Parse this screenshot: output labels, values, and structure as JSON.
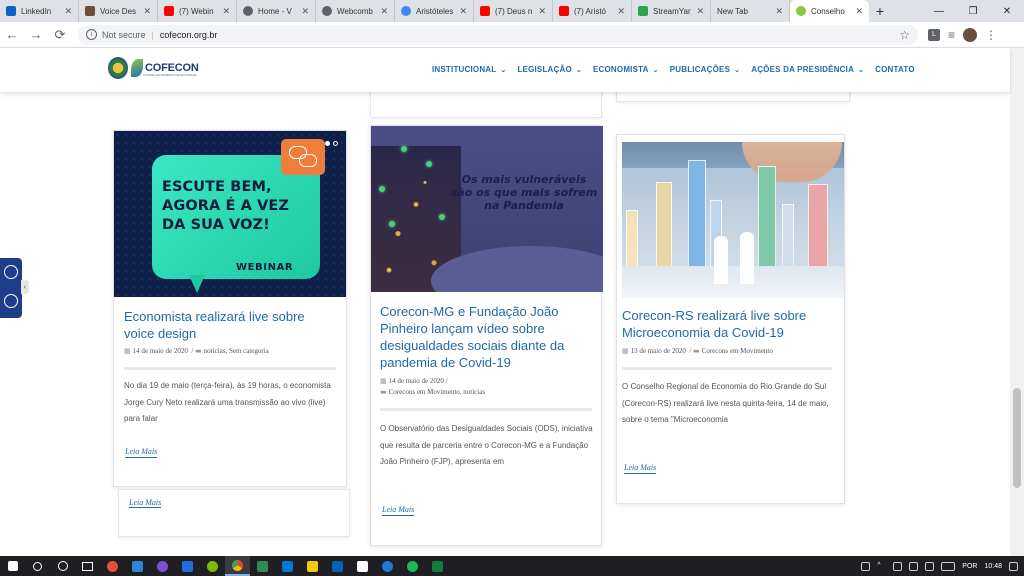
{
  "browser": {
    "tabs": [
      {
        "label": "LinkedIn",
        "color": "#0a66c2"
      },
      {
        "label": "Voice Des",
        "color": "#6b4e3d"
      },
      {
        "label": "(7) Webin",
        "color": "#ff0000"
      },
      {
        "label": "Home - V",
        "color": "#5f6368"
      },
      {
        "label": "Webcomb",
        "color": "#5f6368"
      },
      {
        "label": "Aristóteles",
        "color": "#4285f4"
      },
      {
        "label": "(7) Deus n",
        "color": "#ff0000"
      },
      {
        "label": "(7) Aristó",
        "color": "#ff0000"
      },
      {
        "label": "StreamYar",
        "color": "#2ea44f"
      },
      {
        "label": "New Tab",
        "color": "#dee1e6"
      },
      {
        "label": "Conselho",
        "color": "#8cc63f"
      }
    ],
    "close_glyph": "✕",
    "newtab_glyph": "+",
    "window_controls": [
      "—",
      "❐",
      "✕"
    ],
    "address": {
      "security": "Not secure",
      "separator": "|",
      "url": "cofecon.org.br"
    },
    "nav": {
      "back": "←",
      "forward": "→",
      "reload": "⟳"
    },
    "star": "☆",
    "extension_label": "L",
    "menu_glyph": "⋮",
    "media_glyph": "≡"
  },
  "site": {
    "logo_text": "COFECON",
    "logo_sub": "CONSELHO FEDERAL DE ECONOMIA",
    "nav": [
      {
        "label": "INSTITUCIONAL",
        "chev": "⌄"
      },
      {
        "label": "LEGISLAÇÃO",
        "chev": "⌄"
      },
      {
        "label": "ECONOMISTA",
        "chev": "⌄"
      },
      {
        "label": "PUBLICAÇÕES",
        "chev": "⌄"
      },
      {
        "label": "AÇÕES DA PRESIDÊNCIA",
        "chev": "⌄"
      },
      {
        "label": "CONTATO",
        "chev": ""
      }
    ],
    "accent": "#1f6aa8"
  },
  "posts": [
    {
      "title": "Economista realizará live sobre voice design",
      "date": "14 de maio de 2020",
      "categories": "notícias, Sem categoria",
      "excerpt": "No dia 19 de maio (terça-feira), às 19 horas, o economista Jorge Cury Neto realizará uma transmissão ao vivo (live) para falar",
      "more": "Leia Mais",
      "image_text": {
        "headline": "ESCUTE BEM, AGORA É A VEZ DA SUA VOZ!",
        "badge": "WEBINAR"
      }
    },
    {
      "title": "Corecon-MG e Fundação João Pinheiro lançam vídeo sobre desigualdades sociais diante da pandemia de Covid-19",
      "date": "14 de maio de 2020",
      "categories": "Corecons em Movimento, notícias",
      "excerpt": "O Observatório das Desigualdades Sociais (ODS), iniciativa que resulta de parceria entre o Corecon-MG e a Fundação João Pinheiro (FJP), apresenta em",
      "more": "Leia Mais",
      "image_text": {
        "headline": "Os mais vulneráveis são os que mais sofrem na Pandemia"
      }
    },
    {
      "title": "Corecon-RS realizará live sobre Microeconomia da Covid-19",
      "date": "13 de maio de 2020",
      "categories": "Corecons em Movimento",
      "excerpt": "O Conselho Regional de Economia do Rio Grande do Sul (Corecon-RS) realizará live nesta quinta-feira, 14 de maio, sobre o tema \"Microeconomia",
      "more": "Leia Mais"
    }
  ],
  "extra_more": "Leia Mais",
  "meta_icons": {
    "date": "▦",
    "folder": "▬"
  },
  "a11y_toggle": "‹",
  "taskbar": {
    "apps": [
      "#ffffff",
      "#ffffff",
      "#ffffff",
      "#ffffff",
      "#e84d3d",
      "#2b88d8",
      "#7a4fd8",
      "#1e6fd9",
      "#7fba00",
      "#4285f4",
      "#2e8b57",
      "#0078d7",
      "#f2c811",
      "#0063b1",
      "#ffffff",
      "#1db954",
      "#107c41"
    ],
    "lang": "POR",
    "time": "10:48"
  }
}
